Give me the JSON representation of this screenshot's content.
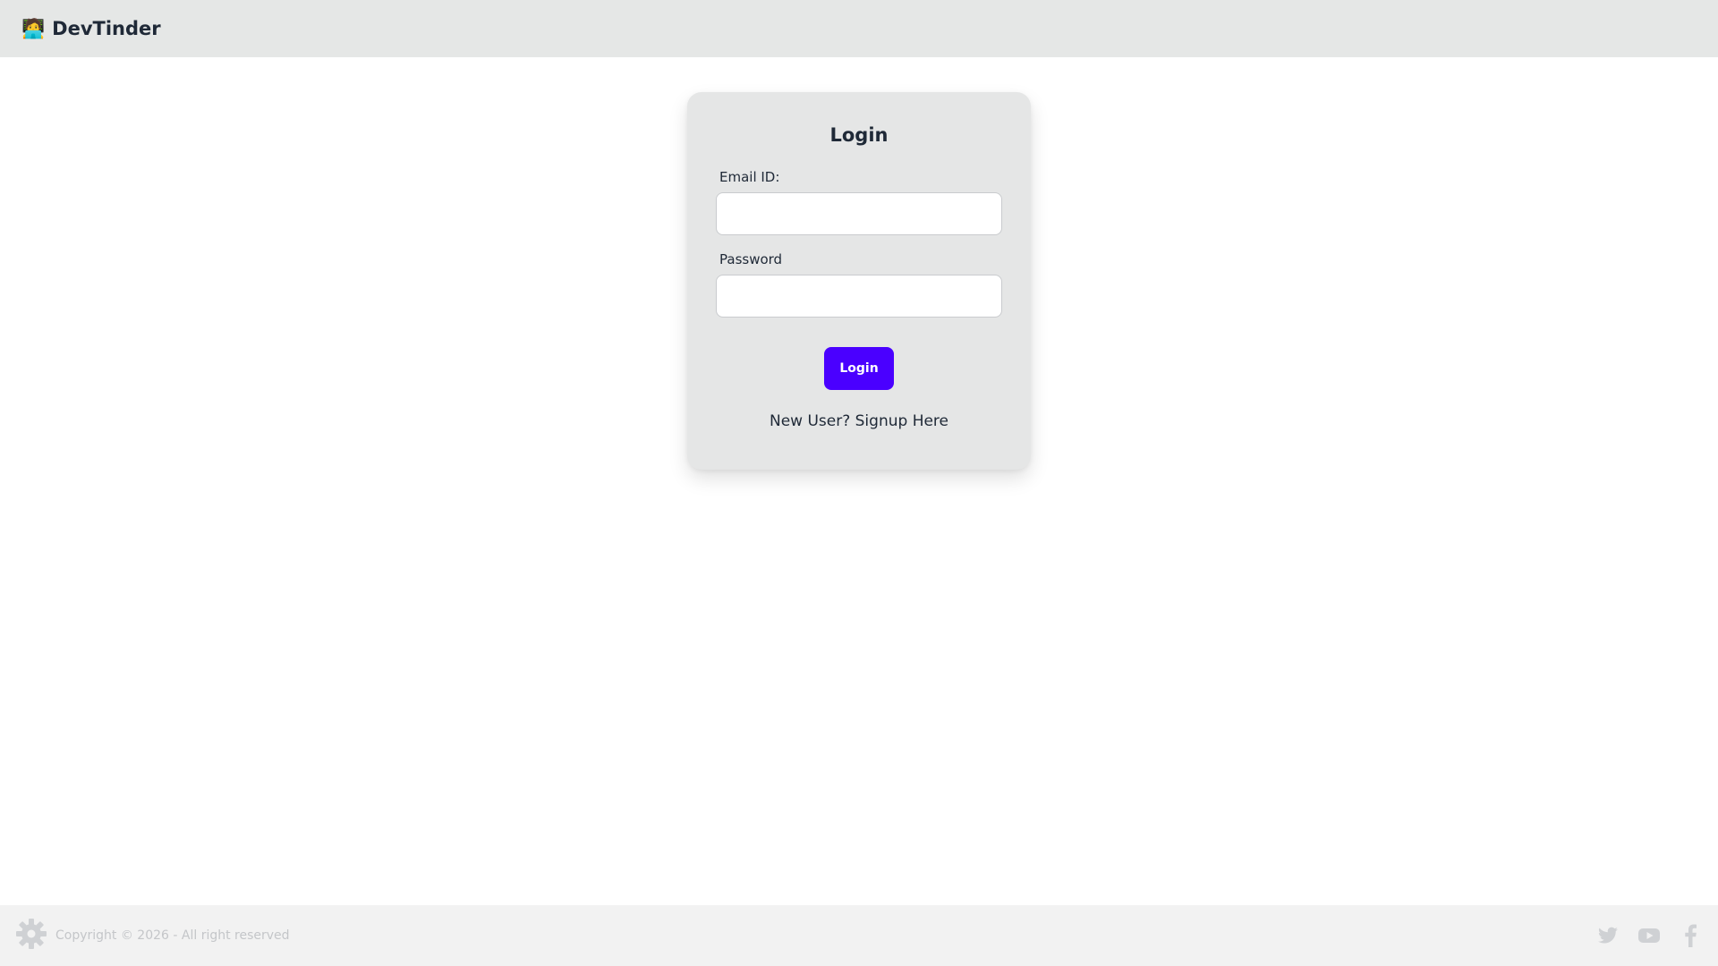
{
  "navbar": {
    "brand_emoji": "🧑‍💻",
    "brand_name": "DevTinder"
  },
  "login_card": {
    "title": "Login",
    "email_label": "Email ID:",
    "email_value": "",
    "password_label": "Password",
    "password_value": "",
    "submit_label": "Login",
    "signup_link": "New User? Signup Here"
  },
  "footer": {
    "copyright": "Copyright © 2026 - All right reserved",
    "logo_icon": "gear-icon",
    "social_icons": [
      "twitter-icon",
      "youtube-icon",
      "facebook-icon"
    ]
  },
  "colors": {
    "navbar_bg": "#e5e7e6",
    "card_bg": "#e5e6e6",
    "primary_button": "#4a00ff",
    "footer_bg": "#f2f2f2",
    "footer_text": "#c4c6c9"
  }
}
